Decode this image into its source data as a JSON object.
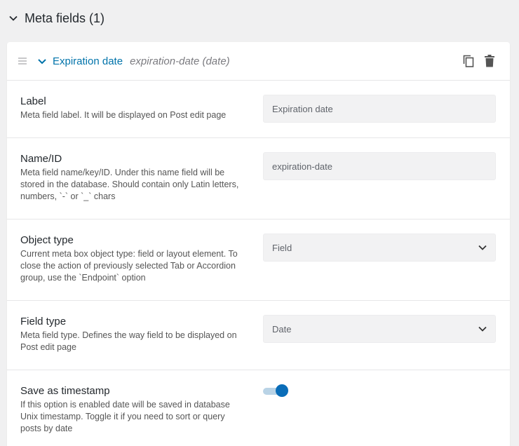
{
  "section": {
    "title": "Meta fields (1)"
  },
  "field": {
    "name": "Expiration date",
    "meta": "expiration-date (date)"
  },
  "rows": {
    "label": {
      "title": "Label",
      "desc": "Meta field label. It will be displayed on Post edit page",
      "value": "Expiration date"
    },
    "name_id": {
      "title": "Name/ID",
      "desc_lines": [
        "Meta field name/key/ID. Under this name field will be",
        "stored in the database. Should contain only Latin letters,",
        "numbers, `-` or `_` chars"
      ],
      "value": "expiration-date"
    },
    "object_type": {
      "title": "Object type",
      "desc_lines": [
        "Current meta box object type: field or layout element. To",
        "close the action of previously selected Tab or Accordion",
        "group, use the `Endpoint` option"
      ],
      "value": "Field"
    },
    "field_type": {
      "title": "Field type",
      "desc_lines": [
        "Meta field type. Defines the way field to be displayed on",
        "Post edit page"
      ],
      "value": "Date"
    },
    "timestamp": {
      "title": "Save as timestamp",
      "desc_lines": [
        "If this option is enabled date will be saved in database",
        "Unix timestamp. Toggle it if you need to sort or query",
        "posts by date"
      ],
      "enabled": true
    }
  },
  "icons": [
    "chevron-down-icon",
    "drag-handle-icon",
    "copy-icon",
    "trash-icon",
    "select-arrow-icon"
  ],
  "colors": {
    "accent": "#0073aa",
    "switch_on": "#0a6db8",
    "switch_track": "#b9d3e6",
    "background": "#f0f0f1"
  }
}
